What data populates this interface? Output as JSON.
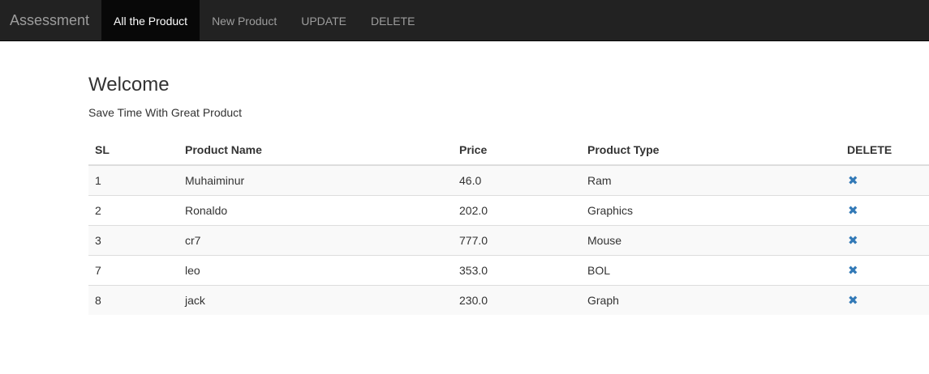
{
  "navbar": {
    "brand": "Assessment",
    "items": [
      {
        "label": "All the Product",
        "active": true
      },
      {
        "label": "New Product",
        "active": false
      },
      {
        "label": "UPDATE",
        "active": false
      },
      {
        "label": "DELETE",
        "active": false
      }
    ]
  },
  "main": {
    "title": "Welcome",
    "subtitle": "Save Time With Great Product"
  },
  "table": {
    "headers": [
      "SL",
      "Product Name",
      "Price",
      "Product Type",
      "DELETE"
    ],
    "rows": [
      {
        "sl": "1",
        "name": "Muhaiminur",
        "price": "46.0",
        "type": "Ram",
        "delete_icon": "✖"
      },
      {
        "sl": "2",
        "name": "Ronaldo",
        "price": "202.0",
        "type": "Graphics",
        "delete_icon": "✖"
      },
      {
        "sl": "3",
        "name": "cr7",
        "price": "777.0",
        "type": "Mouse",
        "delete_icon": "✖"
      },
      {
        "sl": "7",
        "name": "leo",
        "price": "353.0",
        "type": "BOL",
        "delete_icon": "✖"
      },
      {
        "sl": "8",
        "name": "jack",
        "price": "230.0",
        "type": "Graph",
        "delete_icon": "✖"
      }
    ]
  },
  "colors": {
    "navbar_bg": "#222222",
    "navbar_active_bg": "#080808",
    "delete_icon": "#337ab7",
    "striped_row": "#f9f9f9"
  },
  "icons": {
    "delete": "remove-icon"
  }
}
